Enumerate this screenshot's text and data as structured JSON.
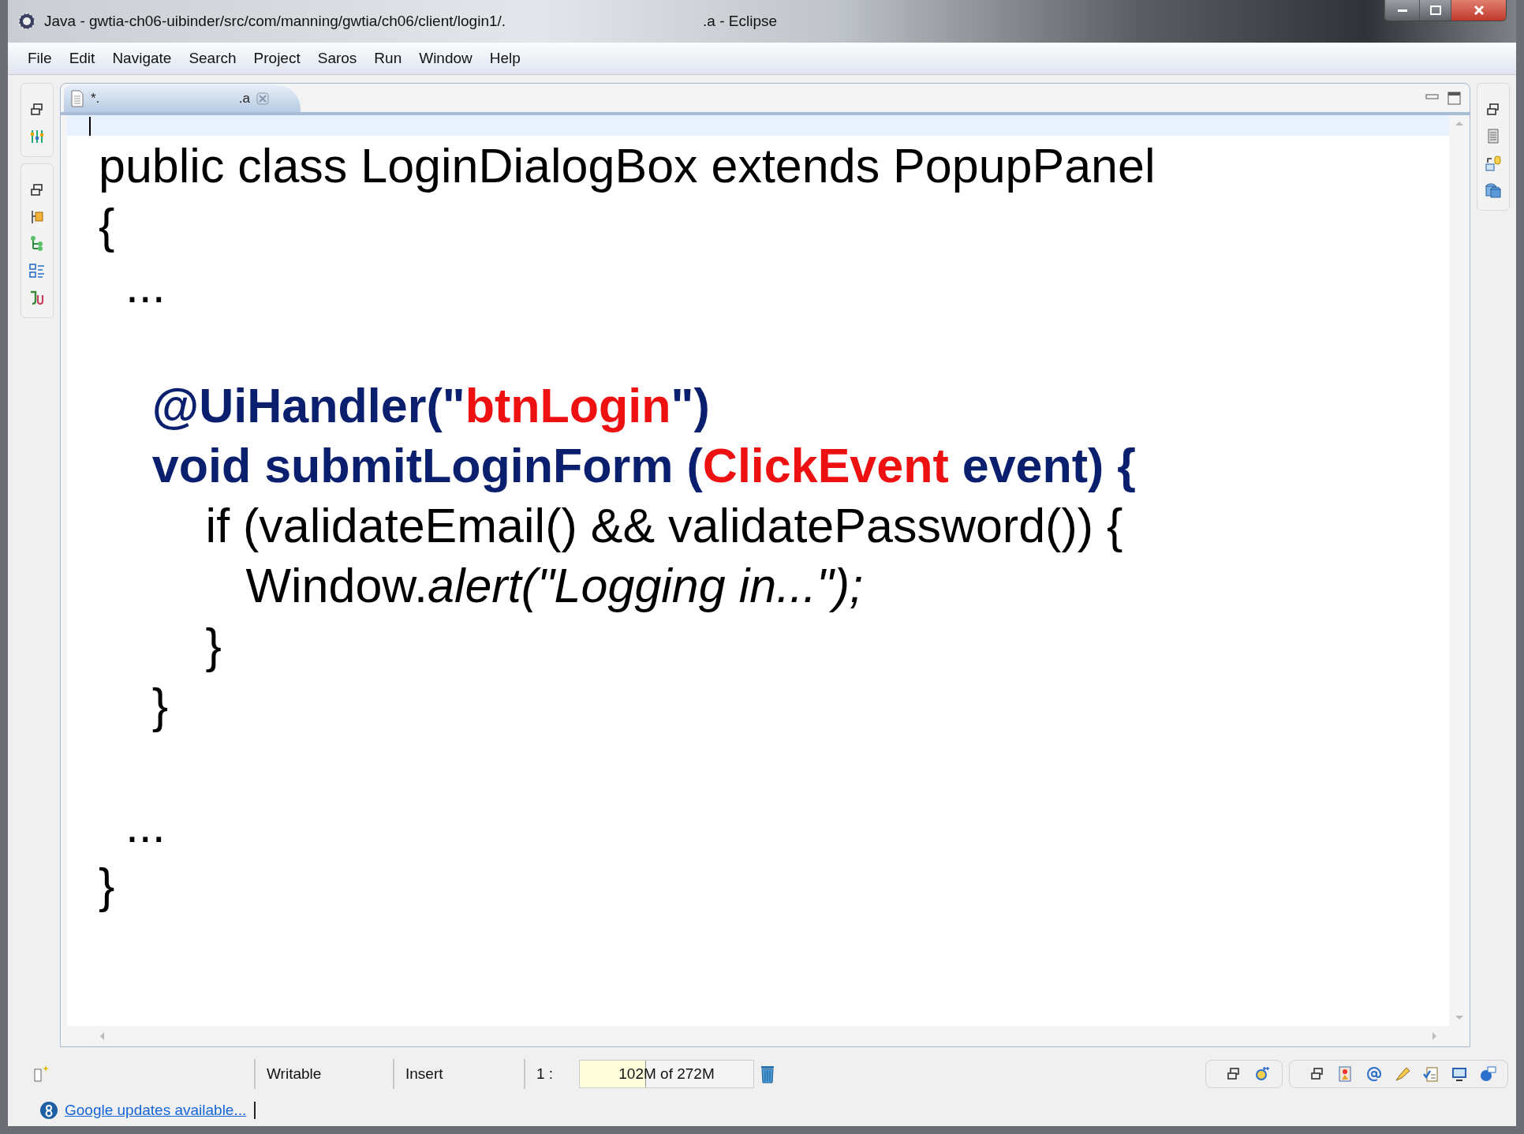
{
  "window": {
    "title": "Java - gwtia-ch06-uibinder/src/com/manning/gwtia/ch06/client/login1/.",
    "title_suffix": ".a - Eclipse"
  },
  "menu": [
    "File",
    "Edit",
    "Navigate",
    "Search",
    "Project",
    "Saros",
    "Run",
    "Window",
    "Help"
  ],
  "editor": {
    "tab": {
      "dirty_mark": "*.",
      "name": ".a",
      "selected": true
    },
    "lines": [
      {
        "kind": "code",
        "segments": [
          {
            "kind": "plain",
            "text": "public class LoginDialogBox extends PopupPanel"
          }
        ]
      },
      {
        "kind": "code",
        "segments": [
          {
            "kind": "plain",
            "text": "{"
          }
        ]
      },
      {
        "kind": "code",
        "segments": [
          {
            "kind": "plain",
            "text": "  ..."
          }
        ]
      },
      {
        "kind": "blank"
      },
      {
        "kind": "code",
        "segments": [
          {
            "kind": "keyword",
            "text": "    @UiHandler(\""
          },
          {
            "kind": "string",
            "text": "btnLogin"
          },
          {
            "kind": "keyword",
            "text": "\")"
          }
        ]
      },
      {
        "kind": "code",
        "segments": [
          {
            "kind": "keyword",
            "text": "    void submitLoginForm ("
          },
          {
            "kind": "string",
            "text": "ClickEvent"
          },
          {
            "kind": "keyword",
            "text": " event) {"
          }
        ]
      },
      {
        "kind": "code",
        "segments": [
          {
            "kind": "plain",
            "text": "        if (validateEmail() && validatePassword()) {"
          }
        ]
      },
      {
        "kind": "code",
        "segments": [
          {
            "kind": "plain",
            "text": "           Window."
          },
          {
            "kind": "italic",
            "text": "alert(\"Logging in...\");"
          }
        ]
      },
      {
        "kind": "code",
        "segments": [
          {
            "kind": "plain",
            "text": "        }"
          }
        ]
      },
      {
        "kind": "code",
        "segments": [
          {
            "kind": "plain",
            "text": "    }"
          }
        ]
      },
      {
        "kind": "blank"
      },
      {
        "kind": "code",
        "segments": [
          {
            "kind": "plain",
            "text": "  ..."
          }
        ]
      },
      {
        "kind": "code",
        "segments": [
          {
            "kind": "plain",
            "text": "}"
          }
        ]
      }
    ]
  },
  "status_bar": {
    "write_mode": "Writable",
    "insert_mode": "Insert",
    "position": "1 :",
    "memory": {
      "text": "102M of 272M",
      "level": 0.375
    },
    "notification": "Google updates available..."
  }
}
